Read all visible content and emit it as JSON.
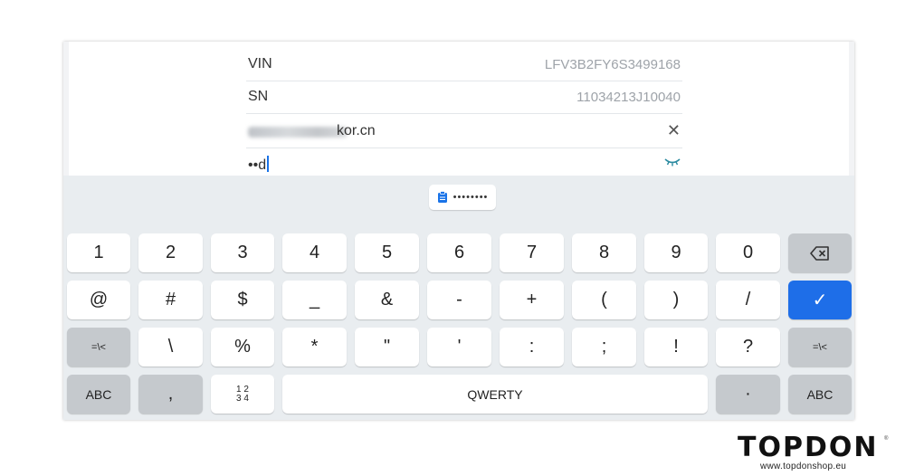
{
  "form": {
    "vin_label": "VIN",
    "vin_value": "LFV3B2FY6S3499168",
    "sn_label": "SN",
    "sn_value": "11034213J10040",
    "email_visible_suffix": "kor.cn",
    "password_value": "••d"
  },
  "clipboard": {
    "suggestion": "••••••••"
  },
  "keyboard": {
    "row1": [
      "1",
      "2",
      "3",
      "4",
      "5",
      "6",
      "7",
      "8",
      "9",
      "0"
    ],
    "row2": [
      "@",
      "#",
      "$",
      "_",
      "&",
      "-",
      "+",
      "(",
      ")",
      "/"
    ],
    "row3": [
      "\\",
      "%",
      "*",
      "\"",
      "'",
      ":",
      ";",
      "!",
      "?"
    ],
    "row3_side": "=\\<",
    "row4_left": "ABC",
    "row4_comma": ",",
    "row4_num_top": "1 2",
    "row4_num_bottom": "3 4",
    "row4_space": "QWERTY",
    "row4_dot": "·",
    "row4_right": "ABC",
    "enter": "✓",
    "backspace": "⌫"
  },
  "brand": {
    "name": "TOPDON",
    "registered": "®",
    "url": "www.topdonshop.eu"
  },
  "colors": {
    "accent": "#1e6ee8",
    "keyboard_bg": "#e9edf0",
    "gray_key": "#c5c9cd"
  }
}
